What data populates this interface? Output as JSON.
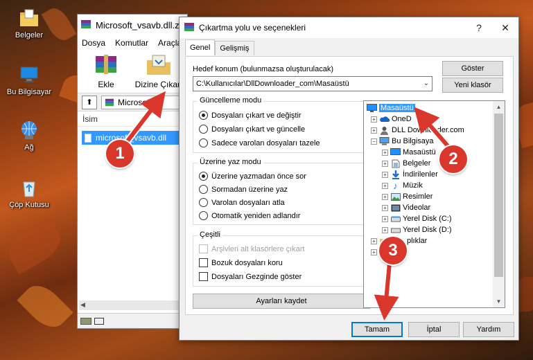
{
  "desktop": {
    "icons": [
      {
        "label": "Belgeler",
        "icon": "documents-folder-icon"
      },
      {
        "label": "Bu Bilgisayar",
        "icon": "computer-icon"
      },
      {
        "label": "Ağ",
        "icon": "network-icon"
      },
      {
        "label": "Çöp Kutusu",
        "icon": "recycle-bin-icon"
      }
    ]
  },
  "winrar": {
    "title": "Microsoft_vsavb.dll.z",
    "menu": [
      "Dosya",
      "Komutlar",
      "Araçla"
    ],
    "toolbar": {
      "add_label": "Ekle",
      "extract_label": "Dizine Çıkart"
    },
    "path": "Microsoft_v",
    "column_name": "İsim",
    "file_name": "microsoft_vsavb.dll"
  },
  "dialog": {
    "title": "Çıkartma yolu ve seçenekleri",
    "help_glyph": "?",
    "close_glyph": "✕",
    "tabs": [
      "Genel",
      "Gelişmiş"
    ],
    "dest_label": "Hedef konum (bulunmazsa oluşturulacak)",
    "dest_value": "C:\\Kullanıcılar\\DllDownloader_com\\Masaüstü",
    "show_button": "Göster",
    "new_folder_button": "Yeni klasör",
    "update_mode": {
      "title": "Güncelleme modu",
      "options": [
        "Dosyaları çıkart ve değiştir",
        "Dosyaları çıkart ve güncelle",
        "Sadece varolan dosyaları tazele"
      ],
      "selected": 0
    },
    "overwrite_mode": {
      "title": "Üzerine yaz modu",
      "options": [
        "Üzerine yazmadan önce sor",
        "Sormadan üzerine yaz",
        "Varolan dosyaları atla",
        "Otomatik yeniden adlandır"
      ],
      "selected": 0
    },
    "misc": {
      "title": "Çeşitli",
      "options": [
        "Arşivleri alt klasörlere çıkart",
        "Bozuk dosyaları koru",
        "Dosyaları Gezginde göster"
      ],
      "disabled": [
        true,
        false,
        false
      ]
    },
    "save_settings_button": "Ayarları kaydet",
    "tree": [
      {
        "label": "Masaüstü",
        "icon": "desktop-icon",
        "selected": true
      },
      {
        "label": "OneD",
        "icon": "onedrive-icon"
      },
      {
        "label": "DLL Downloader.com",
        "icon": "user-folder-icon"
      },
      {
        "label": "Bu Bilgisaya",
        "icon": "computer-icon"
      },
      {
        "label": "Masaüstü",
        "icon": "desktop-icon"
      },
      {
        "label": "Belgeler",
        "icon": "documents-icon"
      },
      {
        "label": "İndirilenler",
        "icon": "downloads-icon"
      },
      {
        "label": "Müzik",
        "icon": "music-icon"
      },
      {
        "label": "Resimler",
        "icon": "pictures-icon"
      },
      {
        "label": "Videolar",
        "icon": "videos-icon"
      },
      {
        "label": "Yerel Disk (C:)",
        "icon": "drive-icon"
      },
      {
        "label": "Yerel Disk (D:)",
        "icon": "drive-icon"
      },
      {
        "label": "plıklar",
        "icon": "libraries-icon"
      }
    ],
    "ok_button": "Tamam",
    "cancel_button": "İptal",
    "help_button": "Yardım"
  },
  "steps": [
    "1",
    "2",
    "3"
  ],
  "colors": {
    "step_badge": "#d9372c",
    "selection": "#3399ff",
    "default_button_border": "#0078d7"
  }
}
